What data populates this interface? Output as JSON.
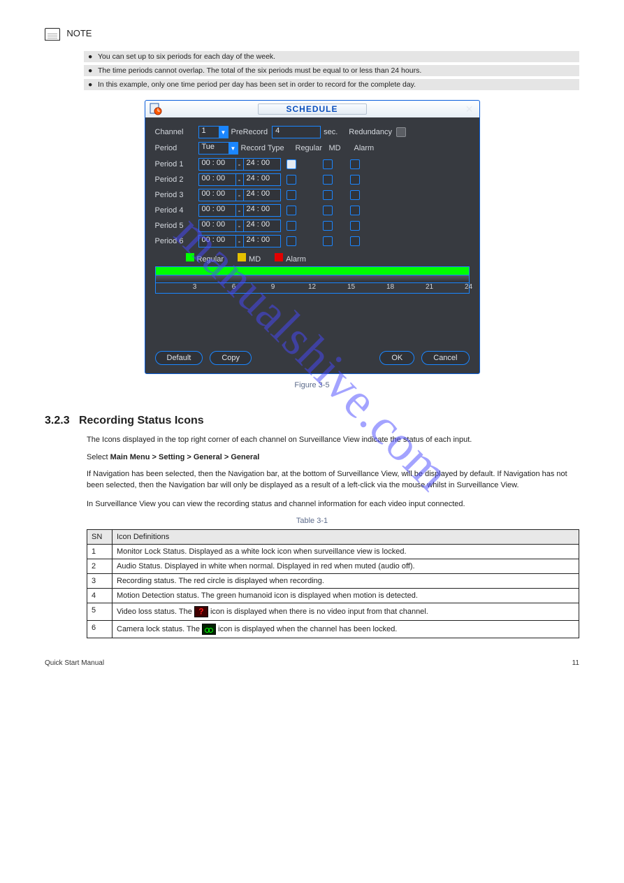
{
  "note_label": "NOTE",
  "note_bullets": [
    "You can set up to six periods for each day of the week.",
    "The time periods cannot overlap. The total of the six periods must be equal to or less than 24 hours.",
    "In this example, only one time period per day has been set in order to record for the complete day."
  ],
  "dlg": {
    "title": "SCHEDULE",
    "row1": {
      "channel_lbl": "Channel",
      "channel_val": "1",
      "prerec_lbl": "PreRecord",
      "prerec_val": "4",
      "sec_lbl": "sec.",
      "redund_lbl": "Redundancy"
    },
    "row2": {
      "period_lbl": "Period",
      "period_val": "Tue",
      "rectype_lbl": "Record Type",
      "reg_lbl": "Regular",
      "md_lbl": "MD",
      "alarm_lbl": "Alarm"
    },
    "periods": [
      {
        "lbl": "Period 1",
        "t1": "00 : 00",
        "t2": "24 : 00",
        "reg": true,
        "md": false,
        "al": false
      },
      {
        "lbl": "Period 2",
        "t1": "00 : 00",
        "t2": "24 : 00",
        "reg": false,
        "md": false,
        "al": false
      },
      {
        "lbl": "Period 3",
        "t1": "00 : 00",
        "t2": "24 : 00",
        "reg": false,
        "md": false,
        "al": false
      },
      {
        "lbl": "Period 4",
        "t1": "00 : 00",
        "t2": "24 : 00",
        "reg": false,
        "md": false,
        "al": false
      },
      {
        "lbl": "Period 5",
        "t1": "00 : 00",
        "t2": "24 : 00",
        "reg": false,
        "md": false,
        "al": false
      },
      {
        "lbl": "Period 6",
        "t1": "00 : 00",
        "t2": "24 : 00",
        "reg": false,
        "md": false,
        "al": false
      }
    ],
    "legend": {
      "reg": "Regular",
      "md": "MD",
      "al": "Alarm"
    },
    "timeline_ticks": [
      "3",
      "6",
      "9",
      "12",
      "15",
      "18",
      "21",
      "24"
    ],
    "buttons": {
      "default": "Default",
      "copy": "Copy",
      "ok": "OK",
      "cancel": "Cancel"
    }
  },
  "fig_cap": "Figure 3-5",
  "watermark": "manualshive.com",
  "section": {
    "no": "3.2.3",
    "title": "Recording Status Icons",
    "para1": "The Icons displayed in the top right corner of each channel on Surveillance View indicate the status of each input.",
    "line2_pre": "Select ",
    "line2_b1": "Main Menu > Setting > General > General",
    "para2": "If Navigation has been selected, then the Navigation bar, at the bottom of Surveillance View, will be displayed by default. If Navigation has not been selected, then the Navigation bar will only be displayed as a result of a left-click via the mouse whilst in Surveillance View.",
    "para3": "In Surveillance View you can view the recording status and channel information for each video input connected."
  },
  "table_cap": "Table 3-1",
  "table": {
    "h1": "SN",
    "h2": "Icon Definitions",
    "rows": [
      {
        "sn": "1",
        "def": "Monitor Lock Status. Displayed as a white lock icon when surveillance view is locked."
      },
      {
        "sn": "2",
        "def": "Audio Status. Displayed in white when normal. Displayed in red when muted (audio off)."
      },
      {
        "sn": "3",
        "def": "Recording status. The red circle is displayed when recording."
      },
      {
        "sn": "4",
        "def": "Motion Detection status. The green humanoid icon is displayed when motion is detected."
      },
      {
        "sn": "5",
        "def_pre": "Video loss status. The ",
        "def_post": " icon is displayed when there is no video input from that channel."
      },
      {
        "sn": "6",
        "def_pre": "Camera lock status. The ",
        "def_post": " icon is displayed when the channel has been locked."
      }
    ]
  },
  "footer_left": "Quick Start Manual",
  "footer_right": "11"
}
